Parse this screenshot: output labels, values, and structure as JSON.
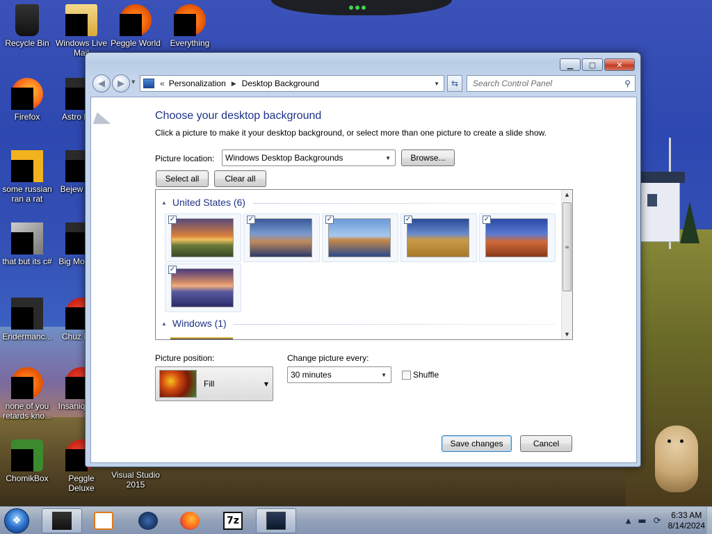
{
  "desktop": {
    "icons": [
      {
        "label": "Recycle Bin",
        "icon": "recycle-bin-icon"
      },
      {
        "label": "Windows Live Mail",
        "icon": "windows-live-mail-icon"
      },
      {
        "label": "Peggle World",
        "icon": "peggle-world-icon"
      },
      {
        "label": "Everything",
        "icon": "everything-search-icon"
      },
      {
        "label": "Firefox",
        "icon": "firefox-icon"
      },
      {
        "label": "Astro Delu",
        "icon": "game-icon"
      },
      {
        "label": "some russian ran a rat",
        "icon": "file-icon"
      },
      {
        "label": "Bejew Delu",
        "icon": "game-icon"
      },
      {
        "label": "that but its c#",
        "icon": "file-icon"
      },
      {
        "label": "Big Mo Delu",
        "icon": "game-icon"
      },
      {
        "label": "Endermanc...",
        "icon": "file-icon"
      },
      {
        "label": "Chuz Delu",
        "icon": "game-icon"
      },
      {
        "label": "none of you retards kno...",
        "icon": "file-icon"
      },
      {
        "label": "Insaniq Delu",
        "icon": "game-icon"
      },
      {
        "label": "ChomikBox",
        "icon": "chomikbox-icon"
      },
      {
        "label": "Peggle Deluxe",
        "icon": "peggle-deluxe-icon"
      },
      {
        "label": "Visual Studio 2015",
        "icon": "visual-studio-icon"
      }
    ]
  },
  "window": {
    "breadcrumb": {
      "overflow": "«",
      "items": [
        "Personalization",
        "Desktop Background"
      ]
    },
    "search_placeholder": "Search Control Panel",
    "title": "Choose your desktop background",
    "subtitle": "Click a picture to make it your desktop background, or select more than one picture to create a slide show.",
    "picture_location": {
      "label": "Picture location:",
      "value": "Windows Desktop Backgrounds"
    },
    "browse_label": "Browse...",
    "select_all_label": "Select all",
    "clear_all_label": "Clear all",
    "groups": [
      {
        "name": "United States (6)",
        "thumbs": [
          {
            "scene": "sunset-field",
            "checked": true
          },
          {
            "scene": "lighthouse",
            "checked": true
          },
          {
            "scene": "rock-reflection",
            "checked": true
          },
          {
            "scene": "hay-bale",
            "checked": true
          },
          {
            "scene": "arch",
            "checked": true
          },
          {
            "scene": "lake-flowers",
            "checked": true
          }
        ]
      },
      {
        "name": "Windows (1)",
        "thumbs": []
      }
    ],
    "picture_position": {
      "label": "Picture position:",
      "value": "Fill"
    },
    "change_every": {
      "label": "Change picture every:",
      "value": "30 minutes"
    },
    "shuffle_label": "Shuffle",
    "save_label": "Save changes",
    "cancel_label": "Cancel"
  },
  "taskbar": {
    "apps": [
      "file-explorer",
      "media-player",
      "globe-app",
      "firefox",
      "7-zip",
      "desktop-background-window"
    ],
    "clock_time": "6:33 AM",
    "clock_date": "8/14/2024"
  }
}
